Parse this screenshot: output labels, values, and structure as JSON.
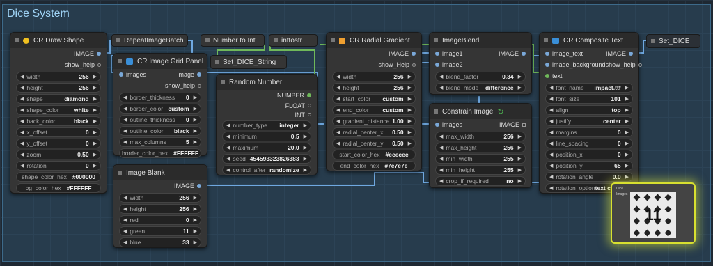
{
  "group_title": "Dice System",
  "nodes": {
    "draw_shape": {
      "title": "CR Draw Shape",
      "outputs": [
        "IMAGE",
        "show_help"
      ],
      "widgets": [
        [
          "width",
          "256"
        ],
        [
          "height",
          "256"
        ],
        [
          "shape",
          "diamond"
        ],
        [
          "shape_color",
          "white"
        ],
        [
          "back_color",
          "black"
        ],
        [
          "x_offset",
          "0"
        ],
        [
          "y_offset",
          "0"
        ],
        [
          "zoom",
          "0.50"
        ],
        [
          "rotation",
          "0"
        ]
      ],
      "texts": [
        [
          "shape_color_hex",
          "#000000"
        ],
        [
          "bg_color_hex",
          "#FFFFFF"
        ]
      ]
    },
    "repeat": {
      "title": "RepeatImageBatch"
    },
    "num_to_int": {
      "title": "Number to Int"
    },
    "inttostr": {
      "title": "inttostr"
    },
    "grid": {
      "title": "CR Image Grid Panel",
      "input": "images",
      "outputs": [
        "image",
        "show_help"
      ],
      "widgets": [
        [
          "border_thickness",
          "0"
        ],
        [
          "border_color",
          "custom"
        ],
        [
          "outline_thickness",
          "0"
        ],
        [
          "outline_color",
          "black"
        ],
        [
          "max_columns",
          "5"
        ]
      ],
      "texts": [
        [
          "border_color_hex",
          "#FFFFFF"
        ]
      ]
    },
    "set_dice_string": {
      "title": "Set_DICE_String"
    },
    "random": {
      "title": "Random Number",
      "outputs": [
        "NUMBER",
        "FLOAT",
        "INT"
      ],
      "widgets": [
        [
          "number_type",
          "integer"
        ],
        [
          "minimum",
          "0.5"
        ],
        [
          "maximum",
          "20.0"
        ],
        [
          "seed",
          "454593323826383"
        ],
        [
          "control_after_",
          "randomize"
        ]
      ]
    },
    "blank": {
      "title": "Image Blank",
      "output": "IMAGE",
      "widgets": [
        [
          "width",
          "256"
        ],
        [
          "height",
          "256"
        ],
        [
          "red",
          "0"
        ],
        [
          "green",
          "11"
        ],
        [
          "blue",
          "33"
        ]
      ]
    },
    "radial": {
      "title": "CR Radial Gradient",
      "outputs": [
        "IMAGE",
        "show_Help"
      ],
      "widgets": [
        [
          "width",
          "256"
        ],
        [
          "height",
          "256"
        ],
        [
          "start_color",
          "custom"
        ],
        [
          "end_color",
          "custom"
        ],
        [
          "gradient_distance",
          "1.00"
        ],
        [
          "radial_center_x",
          "0.50"
        ],
        [
          "radial_center_y",
          "0.50"
        ]
      ],
      "texts": [
        [
          "start_color_hex",
          "#ececec"
        ],
        [
          "end_color_hex",
          "#7e7e7e"
        ]
      ]
    },
    "blend": {
      "title": "ImageBlend",
      "inputs": [
        "image1",
        "image2"
      ],
      "output": "IMAGE",
      "widgets": [
        [
          "blend_factor",
          "0.34"
        ],
        [
          "blend_mode",
          "difference"
        ]
      ]
    },
    "constrain": {
      "title": "Constrain Image",
      "input": "images",
      "output": "IMAGE",
      "widgets": [
        [
          "max_width",
          "256"
        ],
        [
          "max_height",
          "256"
        ],
        [
          "min_width",
          "255"
        ],
        [
          "min_height",
          "255"
        ],
        [
          "crop_if_required",
          "no"
        ]
      ]
    },
    "composite": {
      "title": "CR Composite Text",
      "inputs": [
        "image_text",
        "image_background",
        "text"
      ],
      "outputs": [
        "IMAGE",
        "show_help"
      ],
      "widgets": [
        [
          "font_name",
          "impact.ttf"
        ],
        [
          "font_size",
          "101"
        ],
        [
          "align",
          "top"
        ],
        [
          "justify",
          "center"
        ],
        [
          "margins",
          "0"
        ],
        [
          "line_spacing",
          "0"
        ],
        [
          "position_x",
          "0"
        ],
        [
          "position_y",
          "65"
        ],
        [
          "rotation_angle",
          "0.0"
        ],
        [
          "rotation_option",
          "text center"
        ]
      ]
    },
    "set_dice": {
      "title": "Set_DICE"
    }
  },
  "preview": {
    "number": "11",
    "labels": [
      "Dice",
      "Images"
    ]
  }
}
